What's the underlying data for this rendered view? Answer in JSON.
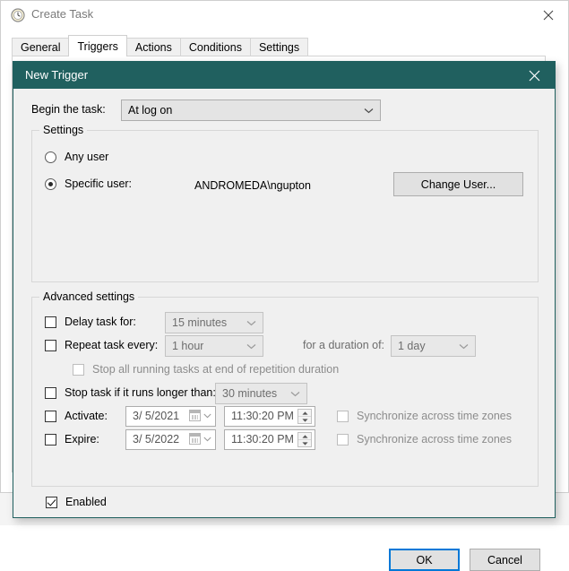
{
  "parent_window": {
    "title": "Create Task",
    "icon": "clock-icon",
    "close_label": "✕",
    "tabs": [
      {
        "label": "General",
        "selected": false
      },
      {
        "label": "Triggers",
        "selected": true
      },
      {
        "label": "Actions",
        "selected": false
      },
      {
        "label": "Conditions",
        "selected": false
      },
      {
        "label": "Settings",
        "selected": false
      }
    ]
  },
  "dialog": {
    "title": "New Trigger",
    "titlebar_color": "#20605f",
    "close_label": "✕",
    "begin_task": {
      "label": "Begin the task:",
      "value": "At log on"
    },
    "settings_group": {
      "title": "Settings",
      "any_user": {
        "label": "Any user",
        "checked": false
      },
      "specific_user": {
        "label": "Specific user:",
        "checked": true,
        "value": "ANDROMEDA\\ngupton"
      },
      "change_user_button": "Change User..."
    },
    "advanced_group": {
      "title": "Advanced settings",
      "delay_task": {
        "label": "Delay task for:",
        "checked": false,
        "value": "15 minutes",
        "enabled": false
      },
      "repeat_task": {
        "label": "Repeat task every:",
        "checked": false,
        "value": "1 hour",
        "enabled": false
      },
      "duration": {
        "label": "for a duration of:",
        "value": "1 day",
        "enabled": false
      },
      "stop_all_running": {
        "label": "Stop all running tasks at end of repetition duration",
        "checked": false,
        "enabled": false
      },
      "stop_task": {
        "label": "Stop task if it runs longer than:",
        "checked": false,
        "value": "30 minutes",
        "enabled": false
      },
      "activate": {
        "label": "Activate:",
        "checked": false,
        "date": "3/  5/2021",
        "time": "11:30:20 PM",
        "sync_label": "Synchronize across time zones",
        "sync_checked": false
      },
      "expire": {
        "label": "Expire:",
        "checked": false,
        "date": "3/  5/2022",
        "time": "11:30:20 PM",
        "sync_label": "Synchronize across time zones",
        "sync_checked": false
      },
      "enabled": {
        "label": "Enabled",
        "checked": true
      }
    },
    "footer": {
      "ok_label": "OK",
      "cancel_label": "Cancel",
      "focus_color": "#0078d7"
    }
  }
}
